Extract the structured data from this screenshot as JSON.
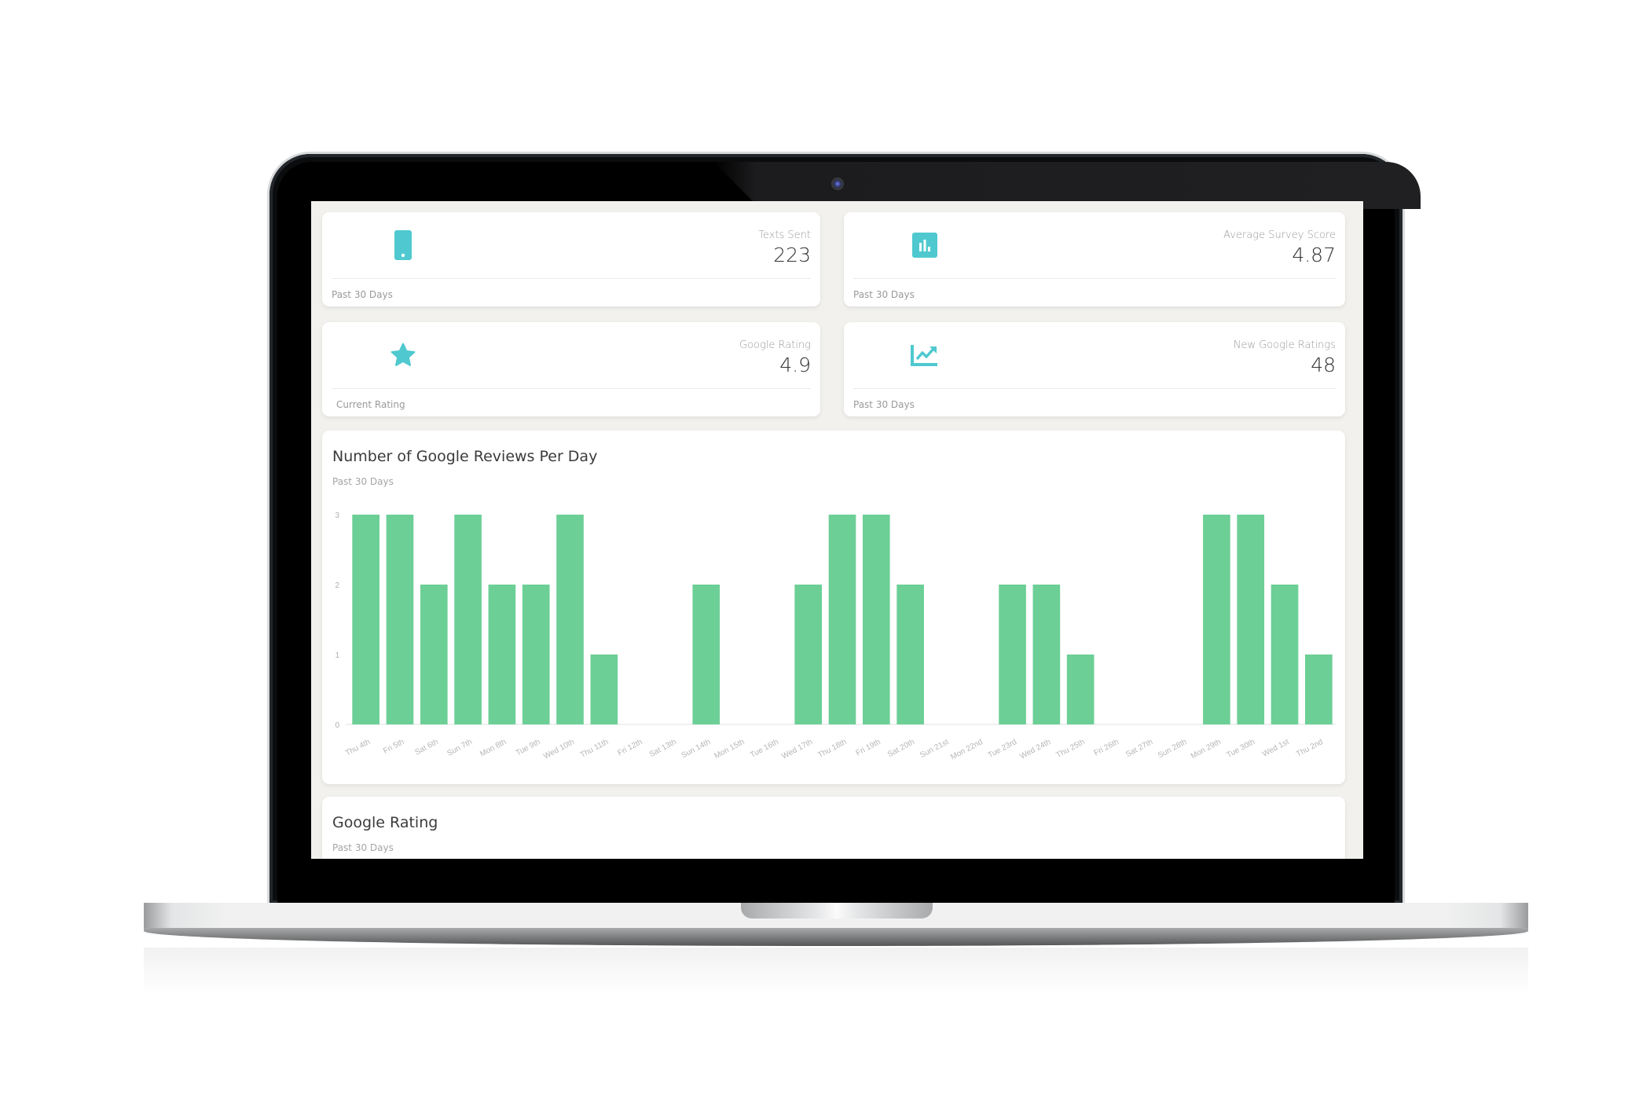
{
  "colors": {
    "accent": "#4fc9cf",
    "bar": "#6ccf96",
    "background": "#f2f1ee"
  },
  "stats": [
    {
      "label": "Texts Sent",
      "value": "223",
      "footer": "Past 30 Days",
      "icon": "phone-icon"
    },
    {
      "label": "Average Survey Score",
      "value": "4.87",
      "footer": "Past 30 Days",
      "icon": "bar-chart-icon"
    },
    {
      "label": "Google Rating",
      "value": "4.9",
      "footer": "Current Rating",
      "icon": "star-icon"
    },
    {
      "label": "New Google Ratings",
      "value": "48",
      "footer": "Past 30 Days",
      "icon": "trend-chart-icon"
    }
  ],
  "reviews_chart": {
    "title": "Number of Google Reviews Per Day",
    "subtitle": "Past 30 Days"
  },
  "rating_card": {
    "title": "Google Rating",
    "subtitle": "Past 30 Days"
  },
  "chart_data": {
    "type": "bar",
    "title": "Number of Google Reviews Per Day",
    "subtitle": "Past 30 Days",
    "xlabel": "",
    "ylabel": "",
    "ylim": [
      0,
      3
    ],
    "yticks": [
      "0",
      "1",
      "2",
      "3"
    ],
    "grid": false,
    "categories": [
      "Thu 4th",
      "Fri 5th",
      "Sat 6th",
      "Sun 7th",
      "Mon 8th",
      "Tue 9th",
      "Wed 10th",
      "Thu 11th",
      "Fri 12th",
      "Sat 13th",
      "Sun 14th",
      "Mon 15th",
      "Tue 16th",
      "Wed 17th",
      "Thu 18th",
      "Fri 19th",
      "Sat 20th",
      "Sun 21st",
      "Mon 22nd",
      "Tue 23rd",
      "Wed 24th",
      "Thu 25th",
      "Fri 26th",
      "Sat 27th",
      "Sun 28th",
      "Mon 29th",
      "Tue 30th",
      "Wed 1st",
      "Thu 2nd"
    ],
    "values": [
      3,
      3,
      2,
      3,
      2,
      2,
      3,
      1,
      0,
      0,
      2,
      0,
      0,
      2,
      3,
      3,
      2,
      0,
      0,
      2,
      2,
      1,
      0,
      0,
      0,
      3,
      3,
      2,
      1
    ]
  }
}
